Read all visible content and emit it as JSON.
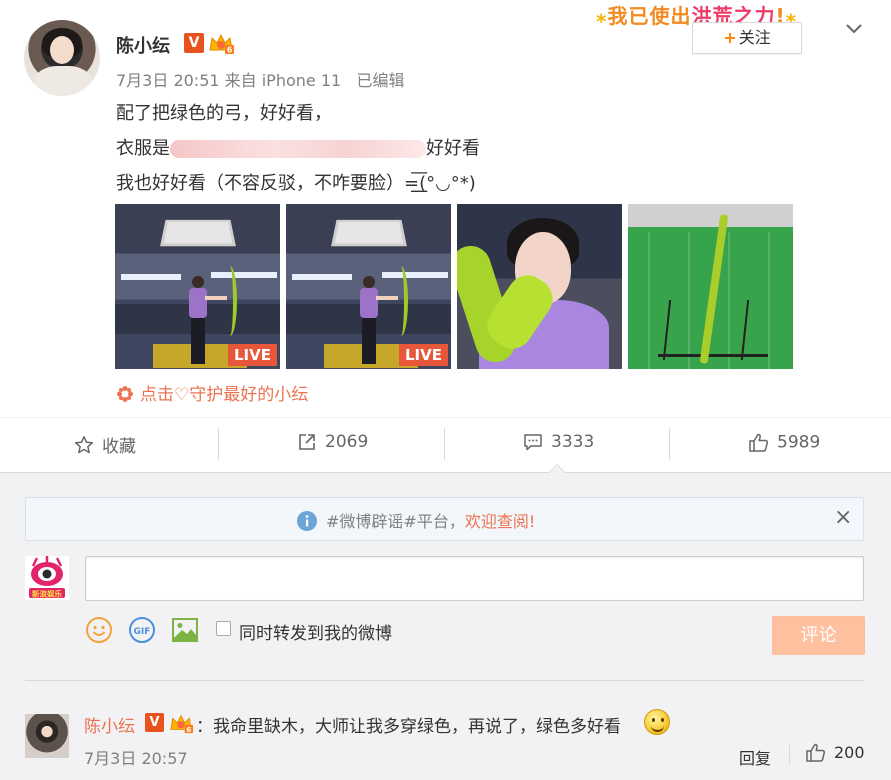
{
  "post": {
    "username": "陈小纭",
    "verified_badge": "V",
    "meta": "7月3日 20:51 来自 iPhone 11   已编辑",
    "lines": {
      "line1": "配了把绿色的弓，好好看，",
      "line2_prefix": "衣服是",
      "line2_suffix": "好好看",
      "line3": "我也好好看（不容反驳，不咋要脸）=͟͟͞͞(๑•̀=•́๑)"
    },
    "line3_display": "我也好好看（不容反驳，不咋要脸）=͟͟͞(°◡°*)",
    "follow_label": "关注",
    "follow_plus": "+",
    "banner_text_a": "我已使出",
    "banner_text_b": "洪荒之力",
    "banner_text_c": "!",
    "images": [
      {
        "type": "live",
        "badge": "LIVE"
      },
      {
        "type": "live",
        "badge": "LIVE"
      },
      {
        "type": "photo"
      },
      {
        "type": "photo"
      }
    ],
    "sub_link": "点击♡守护最好的小纭",
    "sub_link_icon": "flower-icon"
  },
  "actions": {
    "favorite_label": "收藏",
    "repost_count": "2069",
    "comment_count": "3333",
    "like_count": "5989"
  },
  "notice": {
    "text_prefix": "#微博辟谣#平台，",
    "text_link": "欢迎查阅!",
    "close": "×"
  },
  "composer": {
    "input_value": "",
    "also_repost_label": "同时转发到我的微博",
    "submit_label": "评论",
    "avatar_caption": "新浪娱乐"
  },
  "comment": {
    "username": "陈小纭",
    "verified_badge": "V",
    "text": "：我命里缺木，大师让我多穿绿色，再说了，绿色多好看",
    "time": "7月3日 20:57",
    "reply_label": "回复",
    "like_count": "200"
  },
  "colors": {
    "accent_orange": "#eb7350",
    "follow_plus": "#ff8200",
    "live_badge": "#e8573a",
    "submit_disabled": "#ffc09f"
  }
}
